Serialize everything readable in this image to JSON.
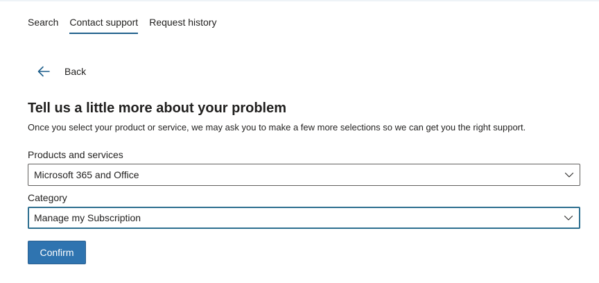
{
  "tabs": [
    {
      "label": "Search",
      "active": false
    },
    {
      "label": "Contact support",
      "active": true
    },
    {
      "label": "Request history",
      "active": false
    }
  ],
  "back": {
    "label": "Back",
    "icon": "arrow-left-icon"
  },
  "heading": "Tell us a little more about your problem",
  "description": "Once you select your product or service, we may ask you to make a few more selections so we can get you the right support.",
  "products": {
    "label": "Products and services",
    "value": "Microsoft 365 and Office"
  },
  "category": {
    "label": "Category",
    "value": "Manage my Subscription"
  },
  "confirm_label": "Confirm",
  "colors": {
    "accent": "#2f74b0",
    "tab_underline": "#1f5f8b",
    "focus_border": "#2c6e8f",
    "text": "#201f1e"
  }
}
